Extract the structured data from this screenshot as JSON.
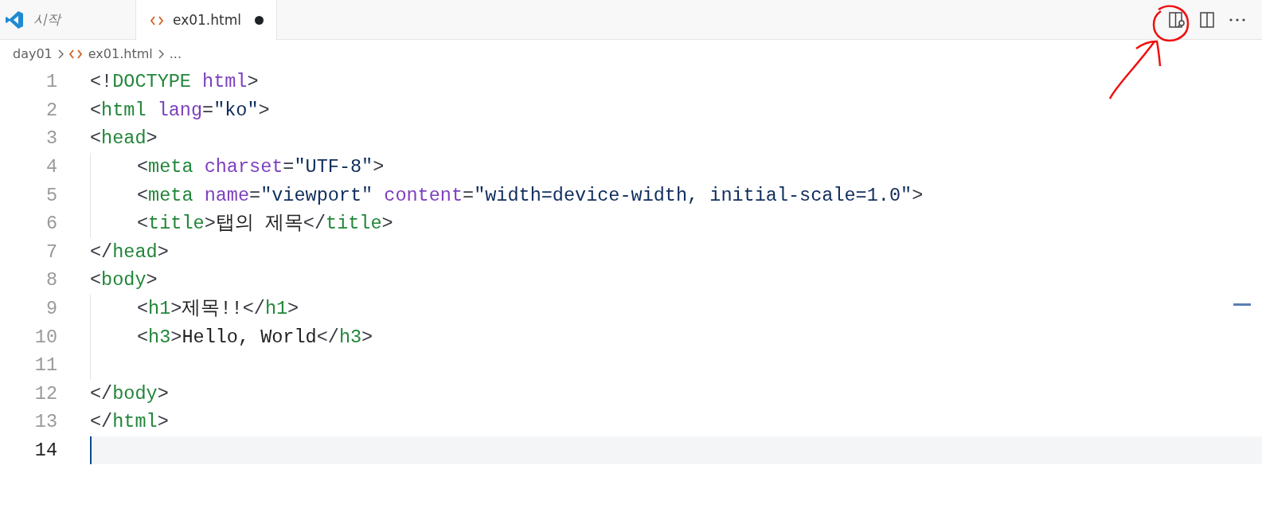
{
  "tabs": [
    {
      "label": "시작",
      "kind": "welcome",
      "preview": true,
      "modified": false,
      "selected": false
    },
    {
      "label": "ex01.html",
      "kind": "file",
      "preview": false,
      "modified": true,
      "selected": true
    }
  ],
  "editor_actions": [
    {
      "kind": "preview"
    },
    {
      "kind": "split"
    },
    {
      "kind": "more"
    }
  ],
  "breadcrumbs": [
    {
      "kind": "folder",
      "label": "day01"
    },
    {
      "kind": "file",
      "label": "ex01.html"
    },
    {
      "kind": "more",
      "label": "..."
    }
  ],
  "lines": [
    {
      "number": "1",
      "selected": false,
      "tokens": [
        {
          "kind": "punct",
          "text": "<!"
        },
        {
          "kind": "tag",
          "text": "DOCTYPE"
        },
        {
          "kind": "attr",
          "text": " html"
        },
        {
          "kind": "punct",
          "text": ">"
        }
      ]
    },
    {
      "number": "2",
      "selected": false,
      "tokens": [
        {
          "kind": "punct",
          "text": "<"
        },
        {
          "kind": "tag",
          "text": "html"
        },
        {
          "kind": "attr",
          "text": " lang"
        },
        {
          "kind": "punct",
          "text": "="
        },
        {
          "kind": "string",
          "text": "\"ko\""
        },
        {
          "kind": "punct",
          "text": ">"
        }
      ]
    },
    {
      "number": "3",
      "selected": false,
      "tokens": [
        {
          "kind": "punct",
          "text": "<"
        },
        {
          "kind": "tag",
          "text": "head"
        },
        {
          "kind": "punct",
          "text": ">"
        }
      ],
      "children": [
        {
          "number": "4",
          "selected": false,
          "tokens": [
            {
              "kind": "punct",
              "text": "<"
            },
            {
              "kind": "tag",
              "text": "meta"
            },
            {
              "kind": "attr",
              "text": " charset"
            },
            {
              "kind": "punct",
              "text": "="
            },
            {
              "kind": "string",
              "text": "\"UTF-8\""
            },
            {
              "kind": "punct",
              "text": ">"
            }
          ]
        },
        {
          "number": "5",
          "selected": false,
          "tokens": [
            {
              "kind": "punct",
              "text": "<"
            },
            {
              "kind": "tag",
              "text": "meta"
            },
            {
              "kind": "attr",
              "text": " name"
            },
            {
              "kind": "punct",
              "text": "="
            },
            {
              "kind": "string",
              "text": "\"viewport\""
            },
            {
              "kind": "attr",
              "text": " content"
            },
            {
              "kind": "punct",
              "text": "="
            },
            {
              "kind": "string",
              "text": "\"width=device-width, initial-scale=1.0\""
            },
            {
              "kind": "punct",
              "text": ">"
            }
          ]
        },
        {
          "number": "6",
          "selected": false,
          "tokens": [
            {
              "kind": "punct",
              "text": "<"
            },
            {
              "kind": "tag",
              "text": "title"
            },
            {
              "kind": "punct",
              "text": ">"
            },
            {
              "kind": "text",
              "text": "탭의 제목"
            },
            {
              "kind": "punct",
              "text": "</"
            },
            {
              "kind": "tag",
              "text": "title"
            },
            {
              "kind": "punct",
              "text": ">"
            }
          ]
        }
      ]
    },
    {
      "number": "7",
      "selected": false,
      "tokens": [
        {
          "kind": "punct",
          "text": "</"
        },
        {
          "kind": "tag",
          "text": "head"
        },
        {
          "kind": "punct",
          "text": ">"
        }
      ]
    },
    {
      "number": "8",
      "selected": false,
      "tokens": [
        {
          "kind": "punct",
          "text": "<"
        },
        {
          "kind": "tag",
          "text": "body"
        },
        {
          "kind": "punct",
          "text": ">"
        }
      ],
      "children": [
        {
          "number": "9",
          "selected": false,
          "tokens": [
            {
              "kind": "punct",
              "text": "<"
            },
            {
              "kind": "tag",
              "text": "h1"
            },
            {
              "kind": "punct",
              "text": ">"
            },
            {
              "kind": "text",
              "text": "제목!!"
            },
            {
              "kind": "punct",
              "text": "</"
            },
            {
              "kind": "tag",
              "text": "h1"
            },
            {
              "kind": "punct",
              "text": ">"
            }
          ]
        },
        {
          "number": "10",
          "selected": false,
          "tokens": [
            {
              "kind": "punct",
              "text": "<"
            },
            {
              "kind": "tag",
              "text": "h3"
            },
            {
              "kind": "punct",
              "text": ">"
            },
            {
              "kind": "text",
              "text": "Hello, World"
            },
            {
              "kind": "punct",
              "text": "</"
            },
            {
              "kind": "tag",
              "text": "h3"
            },
            {
              "kind": "punct",
              "text": ">"
            }
          ]
        },
        {
          "number": "11",
          "selected": false
        }
      ]
    },
    {
      "number": "12",
      "selected": false,
      "tokens": [
        {
          "kind": "punct",
          "text": "</"
        },
        {
          "kind": "tag",
          "text": "body"
        },
        {
          "kind": "punct",
          "text": ">"
        }
      ]
    },
    {
      "number": "13",
      "selected": false,
      "tokens": [
        {
          "kind": "punct",
          "text": "</"
        },
        {
          "kind": "tag",
          "text": "html"
        },
        {
          "kind": "punct",
          "text": ">"
        }
      ]
    },
    {
      "number": "14",
      "selected": true
    }
  ],
  "annotation": {
    "kind": "circled-arrow"
  }
}
